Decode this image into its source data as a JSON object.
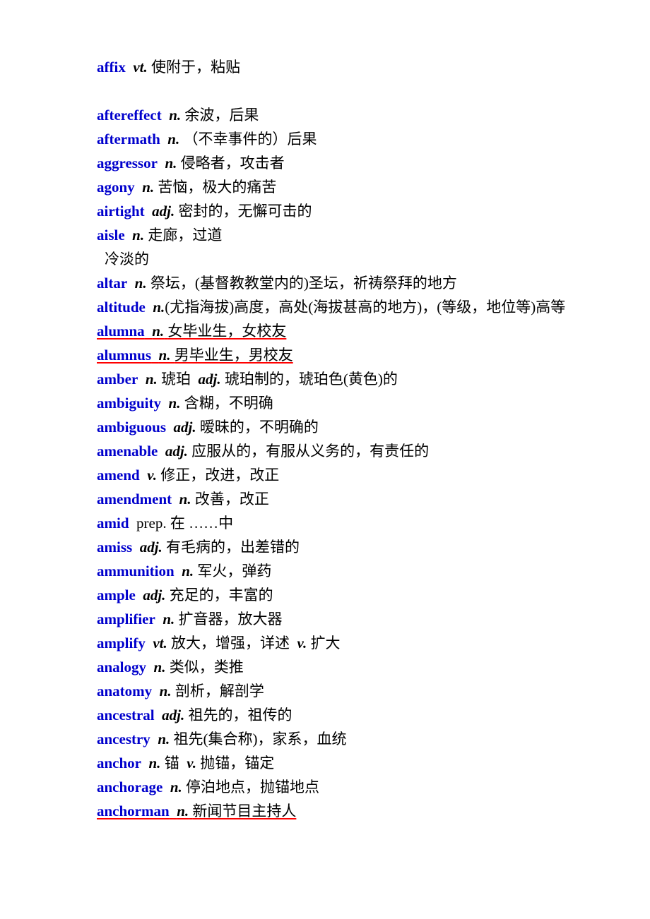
{
  "document": {
    "type": "vocabulary-list",
    "language_pair": "English-Chinese",
    "colors": {
      "headword": "#0000CC",
      "definition": "#000000",
      "revision_underline": "#FF0000",
      "page_background": "#FFFFFF"
    }
  },
  "entries": [
    {
      "headword": "affix",
      "pos": "vt.",
      "pos_italic": true,
      "definition": "使附于，粘贴",
      "marked": false,
      "gap_after": true
    },
    {
      "headword": "aftereffect",
      "pos": "n.",
      "pos_italic": true,
      "definition": "余波，后果",
      "marked": false,
      "gap_after": false
    },
    {
      "headword": "aftermath",
      "pos": "n.",
      "pos_italic": true,
      "definition": "（不幸事件的）后果",
      "marked": false,
      "gap_after": false
    },
    {
      "headword": "aggressor",
      "pos": "n.",
      "pos_italic": true,
      "definition": "侵略者，攻击者",
      "marked": false,
      "gap_after": false
    },
    {
      "headword": "agony",
      "pos": "n.",
      "pos_italic": true,
      "definition": "苦恼，极大的痛苦",
      "marked": false,
      "gap_after": false
    },
    {
      "headword": "airtight",
      "pos": "adj.",
      "pos_italic": true,
      "definition": "密封的，无懈可击的",
      "marked": false,
      "gap_after": false
    },
    {
      "headword": "aisle",
      "pos": "n.",
      "pos_italic": true,
      "definition": "走廊，过道",
      "marked": false,
      "gap_after": false
    },
    {
      "headword": "altar",
      "pos": "n.",
      "pos_italic": true,
      "definition": "祭坛，(基督教教堂内的)圣坛，祈祷祭拜的地方",
      "marked": false,
      "gap_after": false
    },
    {
      "headword": "altitude",
      "pos": "n.",
      "pos_italic": true,
      "definition": "(尤指海拔)高度，高处(海拔甚高的地方)，(等级，地位等)高等",
      "marked": false,
      "gap_after": false,
      "wraps": true,
      "no_space_after_pos": true
    },
    {
      "headword": "alumna",
      "pos": "n.",
      "pos_italic": true,
      "definition": "女毕业生，女校友",
      "marked": true,
      "gap_after": false
    },
    {
      "headword": "alumnus",
      "pos": "n.",
      "pos_italic": true,
      "definition": "男毕业生，男校友",
      "marked": true,
      "gap_after": false
    },
    {
      "headword": "amber",
      "pos": "n.",
      "pos_italic": true,
      "definition": "琥珀",
      "pos2": "adj.",
      "definition2": "琥珀制的，琥珀色(黄色)的",
      "marked": false,
      "gap_after": false
    },
    {
      "headword": "ambiguity",
      "pos": "n.",
      "pos_italic": true,
      "definition": "含糊，不明确",
      "marked": false,
      "gap_after": false
    },
    {
      "headword": "ambiguous",
      "pos": "adj.",
      "pos_italic": true,
      "definition": "暧昧的，不明确的",
      "marked": false,
      "gap_after": false
    },
    {
      "headword": "amenable",
      "pos": "adj.",
      "pos_italic": true,
      "definition": "应服从的，有服从义务的，有责任的",
      "marked": false,
      "gap_after": false
    },
    {
      "headword": "amend",
      "pos": "v.",
      "pos_italic": true,
      "definition": "修正，改进，改正",
      "marked": false,
      "gap_after": false
    },
    {
      "headword": "amendment",
      "pos": "n.",
      "pos_italic": true,
      "definition": "改善，改正",
      "marked": false,
      "gap_after": false
    },
    {
      "headword": "amid",
      "pos": "prep.",
      "pos_italic": false,
      "definition": "在 ……中",
      "marked": false,
      "gap_after": false
    },
    {
      "headword": "amiss",
      "pos": "adj.",
      "pos_italic": true,
      "definition": "有毛病的，出差错的",
      "marked": false,
      "gap_after": false
    },
    {
      "headword": "ammunition",
      "pos": "n.",
      "pos_italic": true,
      "definition": "军火，弹药",
      "marked": false,
      "gap_after": false
    },
    {
      "headword": "ample",
      "pos": "adj.",
      "pos_italic": true,
      "definition": "充足的，丰富的",
      "marked": false,
      "gap_after": false
    },
    {
      "headword": "amplifier",
      "pos": "n.",
      "pos_italic": true,
      "definition": "扩音器，放大器",
      "marked": false,
      "gap_after": false
    },
    {
      "headword": "amplify",
      "pos": "vt.",
      "pos_italic": true,
      "definition": "放大，增强，详述",
      "pos2": "v.",
      "definition2": "扩大",
      "marked": false,
      "gap_after": false
    },
    {
      "headword": "analogy",
      "pos": "n.",
      "pos_italic": true,
      "definition": "类似，类推",
      "marked": false,
      "gap_after": false
    },
    {
      "headword": "anatomy",
      "pos": "n.",
      "pos_italic": true,
      "definition": "剖析，解剖学",
      "marked": false,
      "gap_after": false
    },
    {
      "headword": "ancestral",
      "pos": "adj.",
      "pos_italic": true,
      "definition": "祖先的，祖传的",
      "marked": false,
      "gap_after": false
    },
    {
      "headword": "ancestry",
      "pos": "n.",
      "pos_italic": true,
      "definition": "祖先(集合称)，家系，血统",
      "marked": false,
      "gap_after": false
    },
    {
      "headword": "anchor",
      "pos": "n.",
      "pos_italic": true,
      "definition": "锚",
      "pos2": "v.",
      "definition2": "抛锚，锚定",
      "marked": false,
      "gap_after": false
    },
    {
      "headword": "anchorage",
      "pos": "n.",
      "pos_italic": true,
      "definition": "停泊地点，抛锚地点",
      "marked": false,
      "gap_after": false
    },
    {
      "headword": "anchorman",
      "pos": "n.",
      "pos_italic": true,
      "definition": "新闻节目主持人",
      "marked": true,
      "gap_after": false
    }
  ],
  "orphan_lines": [
    {
      "after_entry_index": 6,
      "text": "冷淡的"
    }
  ]
}
